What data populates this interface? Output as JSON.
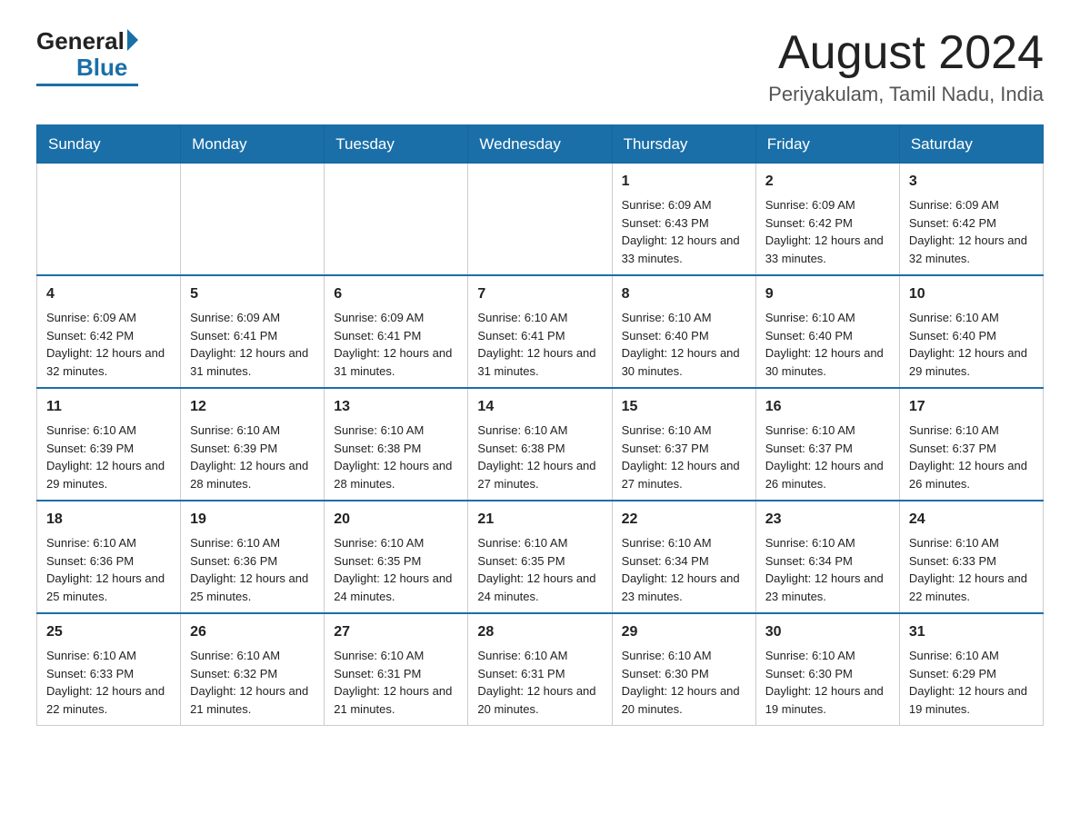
{
  "logo": {
    "general": "General",
    "blue": "Blue"
  },
  "header": {
    "month": "August 2024",
    "location": "Periyakulam, Tamil Nadu, India"
  },
  "days_of_week": [
    "Sunday",
    "Monday",
    "Tuesday",
    "Wednesday",
    "Thursday",
    "Friday",
    "Saturday"
  ],
  "weeks": [
    [
      {
        "day": "",
        "sunrise": "",
        "sunset": "",
        "daylight": ""
      },
      {
        "day": "",
        "sunrise": "",
        "sunset": "",
        "daylight": ""
      },
      {
        "day": "",
        "sunrise": "",
        "sunset": "",
        "daylight": ""
      },
      {
        "day": "",
        "sunrise": "",
        "sunset": "",
        "daylight": ""
      },
      {
        "day": "1",
        "sunrise": "Sunrise: 6:09 AM",
        "sunset": "Sunset: 6:43 PM",
        "daylight": "Daylight: 12 hours and 33 minutes."
      },
      {
        "day": "2",
        "sunrise": "Sunrise: 6:09 AM",
        "sunset": "Sunset: 6:42 PM",
        "daylight": "Daylight: 12 hours and 33 minutes."
      },
      {
        "day": "3",
        "sunrise": "Sunrise: 6:09 AM",
        "sunset": "Sunset: 6:42 PM",
        "daylight": "Daylight: 12 hours and 32 minutes."
      }
    ],
    [
      {
        "day": "4",
        "sunrise": "Sunrise: 6:09 AM",
        "sunset": "Sunset: 6:42 PM",
        "daylight": "Daylight: 12 hours and 32 minutes."
      },
      {
        "day": "5",
        "sunrise": "Sunrise: 6:09 AM",
        "sunset": "Sunset: 6:41 PM",
        "daylight": "Daylight: 12 hours and 31 minutes."
      },
      {
        "day": "6",
        "sunrise": "Sunrise: 6:09 AM",
        "sunset": "Sunset: 6:41 PM",
        "daylight": "Daylight: 12 hours and 31 minutes."
      },
      {
        "day": "7",
        "sunrise": "Sunrise: 6:10 AM",
        "sunset": "Sunset: 6:41 PM",
        "daylight": "Daylight: 12 hours and 31 minutes."
      },
      {
        "day": "8",
        "sunrise": "Sunrise: 6:10 AM",
        "sunset": "Sunset: 6:40 PM",
        "daylight": "Daylight: 12 hours and 30 minutes."
      },
      {
        "day": "9",
        "sunrise": "Sunrise: 6:10 AM",
        "sunset": "Sunset: 6:40 PM",
        "daylight": "Daylight: 12 hours and 30 minutes."
      },
      {
        "day": "10",
        "sunrise": "Sunrise: 6:10 AM",
        "sunset": "Sunset: 6:40 PM",
        "daylight": "Daylight: 12 hours and 29 minutes."
      }
    ],
    [
      {
        "day": "11",
        "sunrise": "Sunrise: 6:10 AM",
        "sunset": "Sunset: 6:39 PM",
        "daylight": "Daylight: 12 hours and 29 minutes."
      },
      {
        "day": "12",
        "sunrise": "Sunrise: 6:10 AM",
        "sunset": "Sunset: 6:39 PM",
        "daylight": "Daylight: 12 hours and 28 minutes."
      },
      {
        "day": "13",
        "sunrise": "Sunrise: 6:10 AM",
        "sunset": "Sunset: 6:38 PM",
        "daylight": "Daylight: 12 hours and 28 minutes."
      },
      {
        "day": "14",
        "sunrise": "Sunrise: 6:10 AM",
        "sunset": "Sunset: 6:38 PM",
        "daylight": "Daylight: 12 hours and 27 minutes."
      },
      {
        "day": "15",
        "sunrise": "Sunrise: 6:10 AM",
        "sunset": "Sunset: 6:37 PM",
        "daylight": "Daylight: 12 hours and 27 minutes."
      },
      {
        "day": "16",
        "sunrise": "Sunrise: 6:10 AM",
        "sunset": "Sunset: 6:37 PM",
        "daylight": "Daylight: 12 hours and 26 minutes."
      },
      {
        "day": "17",
        "sunrise": "Sunrise: 6:10 AM",
        "sunset": "Sunset: 6:37 PM",
        "daylight": "Daylight: 12 hours and 26 minutes."
      }
    ],
    [
      {
        "day": "18",
        "sunrise": "Sunrise: 6:10 AM",
        "sunset": "Sunset: 6:36 PM",
        "daylight": "Daylight: 12 hours and 25 minutes."
      },
      {
        "day": "19",
        "sunrise": "Sunrise: 6:10 AM",
        "sunset": "Sunset: 6:36 PM",
        "daylight": "Daylight: 12 hours and 25 minutes."
      },
      {
        "day": "20",
        "sunrise": "Sunrise: 6:10 AM",
        "sunset": "Sunset: 6:35 PM",
        "daylight": "Daylight: 12 hours and 24 minutes."
      },
      {
        "day": "21",
        "sunrise": "Sunrise: 6:10 AM",
        "sunset": "Sunset: 6:35 PM",
        "daylight": "Daylight: 12 hours and 24 minutes."
      },
      {
        "day": "22",
        "sunrise": "Sunrise: 6:10 AM",
        "sunset": "Sunset: 6:34 PM",
        "daylight": "Daylight: 12 hours and 23 minutes."
      },
      {
        "day": "23",
        "sunrise": "Sunrise: 6:10 AM",
        "sunset": "Sunset: 6:34 PM",
        "daylight": "Daylight: 12 hours and 23 minutes."
      },
      {
        "day": "24",
        "sunrise": "Sunrise: 6:10 AM",
        "sunset": "Sunset: 6:33 PM",
        "daylight": "Daylight: 12 hours and 22 minutes."
      }
    ],
    [
      {
        "day": "25",
        "sunrise": "Sunrise: 6:10 AM",
        "sunset": "Sunset: 6:33 PM",
        "daylight": "Daylight: 12 hours and 22 minutes."
      },
      {
        "day": "26",
        "sunrise": "Sunrise: 6:10 AM",
        "sunset": "Sunset: 6:32 PM",
        "daylight": "Daylight: 12 hours and 21 minutes."
      },
      {
        "day": "27",
        "sunrise": "Sunrise: 6:10 AM",
        "sunset": "Sunset: 6:31 PM",
        "daylight": "Daylight: 12 hours and 21 minutes."
      },
      {
        "day": "28",
        "sunrise": "Sunrise: 6:10 AM",
        "sunset": "Sunset: 6:31 PM",
        "daylight": "Daylight: 12 hours and 20 minutes."
      },
      {
        "day": "29",
        "sunrise": "Sunrise: 6:10 AM",
        "sunset": "Sunset: 6:30 PM",
        "daylight": "Daylight: 12 hours and 20 minutes."
      },
      {
        "day": "30",
        "sunrise": "Sunrise: 6:10 AM",
        "sunset": "Sunset: 6:30 PM",
        "daylight": "Daylight: 12 hours and 19 minutes."
      },
      {
        "day": "31",
        "sunrise": "Sunrise: 6:10 AM",
        "sunset": "Sunset: 6:29 PM",
        "daylight": "Daylight: 12 hours and 19 minutes."
      }
    ]
  ]
}
